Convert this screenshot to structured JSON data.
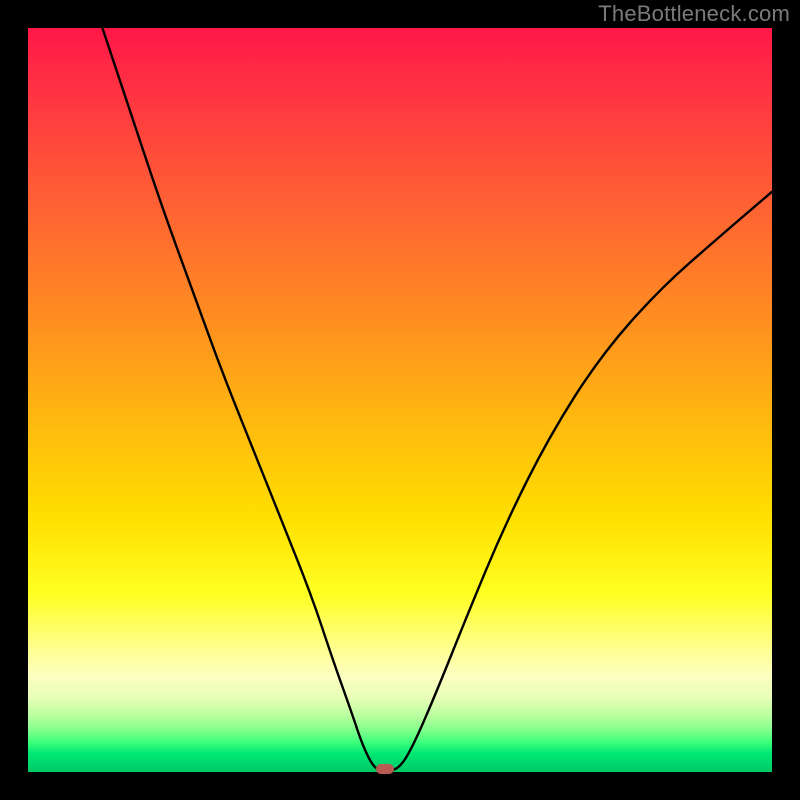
{
  "watermark": "TheBottleneck.com",
  "colors": {
    "frame": "#000000",
    "curve": "#000000",
    "marker": "#b95a52",
    "gradient_top": "#ff1748",
    "gradient_bottom": "#00c964"
  },
  "chart_data": {
    "type": "line",
    "title": "",
    "xlabel": "",
    "ylabel": "",
    "xlim": [
      0,
      100
    ],
    "ylim": [
      0,
      100
    ],
    "grid": false,
    "legend": false,
    "notes": "No axis ticks or numeric labels are rendered; values are proportional (0–100 of plot width/height). Single black V-shaped curve over a vertical red→green gradient. A small rounded marker sits at the curve minimum.",
    "series": [
      {
        "name": "bottleneck-curve",
        "x": [
          10,
          14,
          18,
          22,
          26,
          30,
          34,
          38,
          41,
          43.5,
          45,
          46.5,
          48,
          50,
          52,
          55,
          59,
          64,
          70,
          77,
          85,
          93,
          100
        ],
        "y": [
          100,
          88,
          76,
          65,
          54,
          44,
          34,
          24,
          15,
          8,
          3.5,
          0.5,
          0,
          0.5,
          4,
          11,
          21,
          33,
          45,
          56,
          65,
          72,
          78
        ]
      }
    ],
    "marker": {
      "x": 48,
      "y": 0
    }
  }
}
